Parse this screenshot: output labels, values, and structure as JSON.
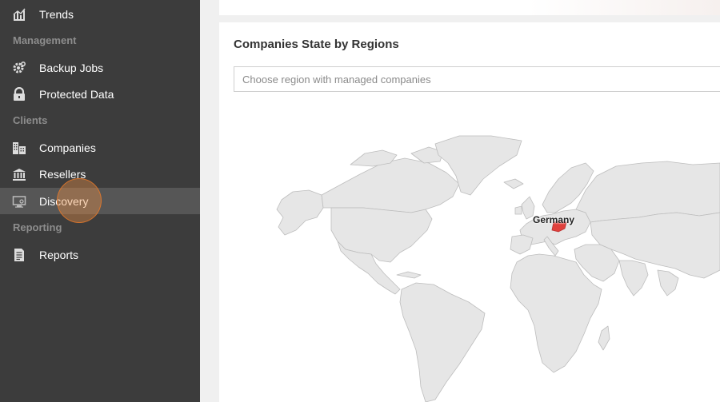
{
  "sidebar": {
    "items": [
      {
        "label": "Trends",
        "icon": "trends-icon"
      },
      {
        "label": "Backup Jobs",
        "icon": "gear-icon"
      },
      {
        "label": "Protected Data",
        "icon": "lock-icon"
      },
      {
        "label": "Companies",
        "icon": "buildings-icon"
      },
      {
        "label": "Resellers",
        "icon": "bank-icon"
      },
      {
        "label": "Discovery",
        "icon": "monitor-icon"
      },
      {
        "label": "Reports",
        "icon": "document-icon"
      }
    ],
    "sections": {
      "management": "Management",
      "clients": "Clients",
      "reporting": "Reporting"
    },
    "active_item": "Discovery"
  },
  "main": {
    "card_title": "Companies State by Regions",
    "region_placeholder": "Choose region with managed companies",
    "map": {
      "highlighted_country": "Germany",
      "highlight_color": "#e0403c",
      "land_color": "#e6e6e6",
      "border_color": "#bdbdbd"
    }
  },
  "colors": {
    "sidebar_bg": "#3c3c3c",
    "sidebar_active_bg": "#565656",
    "section_label": "#8d8d8d",
    "click_indicator": "#f39448"
  }
}
